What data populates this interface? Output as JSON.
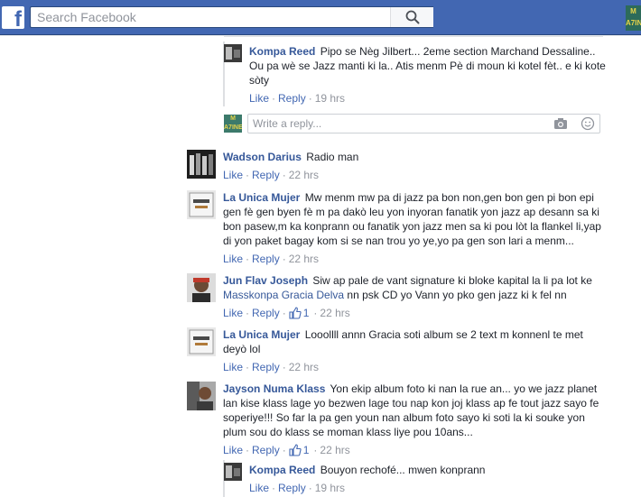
{
  "search": {
    "placeholder": "Search Facebook"
  },
  "header": {
    "logo": "f",
    "corner_badge": "M A7IN"
  },
  "comments": [
    {
      "author": "Kompa Reed",
      "text": "Pipo se Nèg Jilbert... 2eme section Marchand Dessaline.. Ou pa wè se Jazz manti ki la.. Atis menm Pè di moun ki kotel fèt.. e ki kote sòty",
      "like": "Like",
      "reply": "Reply",
      "time": "19 hrs"
    },
    {
      "author": "Wadson Darius",
      "text": "Radio man",
      "like": "Like",
      "reply": "Reply",
      "time": "22 hrs"
    },
    {
      "author": "La Unica Mujer",
      "text": "Mw menm mw pa di jazz pa bon non,gen bon gen pi bon epi gen fè gen byen fè m pa dakò leu yon inyoran fanatik yon jazz ap desann sa ki bon pasew,m ka konprann ou fanatik yon jazz men sa ki pou lòt la flankel li,yap di yon paket bagay kom si se nan trou yo ye,yo pa gen son lari a menm...",
      "like": "Like",
      "reply": "Reply",
      "time": "22 hrs"
    },
    {
      "author": "Jun Flav Joseph",
      "text_before": "Siw ap pale de vant signature ki bloke kapital la li pa lot ke ",
      "link": "Masskonpa Gracia Delva",
      "text_after": " nn psk CD yo Vann yo pko gen jazz ki k fel nn",
      "like": "Like",
      "reply": "Reply",
      "likes": "1",
      "time": "22 hrs"
    },
    {
      "author": "La Unica Mujer",
      "text": "Looollll annn Gracia soti album se 2 text m konnenl te met deyò lol",
      "like": "Like",
      "reply": "Reply",
      "time": "22 hrs"
    },
    {
      "author": "Jayson Numa Klass",
      "text": "Yon ekip album foto ki nan la rue an... yo we jazz planet lan kise klass lage yo bezwen lage tou nap kon joj klass ap fe tout jazz sayo fe soperiye!!! So far la pa gen youn nan album foto sayo ki soti la ki souke yon plum sou do klass se moman klass liye pou 10ans...",
      "like": "Like",
      "reply": "Reply",
      "likes": "1",
      "time": "22 hrs"
    },
    {
      "author": "Kompa Reed",
      "text": "Bouyon rechofé... mwen konprann",
      "like": "Like",
      "reply": "Reply",
      "time": "19 hrs"
    }
  ],
  "reply_box": {
    "placeholder": "Write a reply...",
    "avatar_text": "M A7INE"
  },
  "colors": {
    "topbar": "#4267b2",
    "author": "#365899",
    "meta": "#90949c"
  }
}
